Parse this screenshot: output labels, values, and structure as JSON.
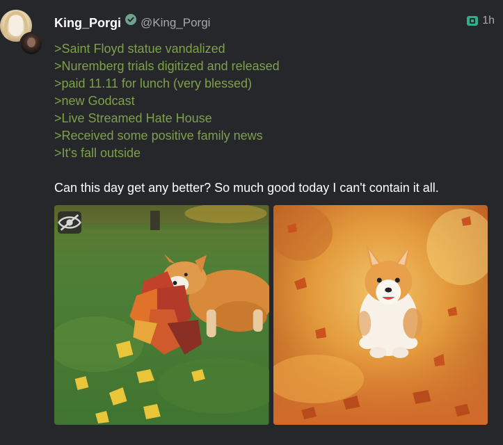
{
  "post": {
    "author": {
      "display_name": "King_Porgi",
      "handle": "@King_Porgi",
      "verified": true,
      "avatar_icon": "user-avatar",
      "secondary_avatar_icon": "user-avatar"
    },
    "meta": {
      "app_icon": "client-app-icon",
      "time": "1h"
    },
    "greentext_lines": [
      ">Saint Floyd statue vandalized",
      ">Nuremberg trials digitized and released",
      ">paid 11.11 for lunch (very blessed)",
      ">new Godcast",
      ">Live Streamed Hate House",
      ">Received some positive family news",
      ">It's fall outside"
    ],
    "body": "Can this day get any better? So much good today I can't contain it all.",
    "media": [
      {
        "subject": "corgi-with-autumn-leaves",
        "hide_icon": "eye-slash-icon"
      },
      {
        "subject": "corgi-running-in-autumn-leaves"
      }
    ]
  },
  "colors": {
    "background": "#26272b",
    "greentext": "#7fa04a",
    "name": "#ffffff",
    "muted": "#a8a9ad",
    "verified": "#6fa38f",
    "app_icon": "#2fae8a"
  }
}
